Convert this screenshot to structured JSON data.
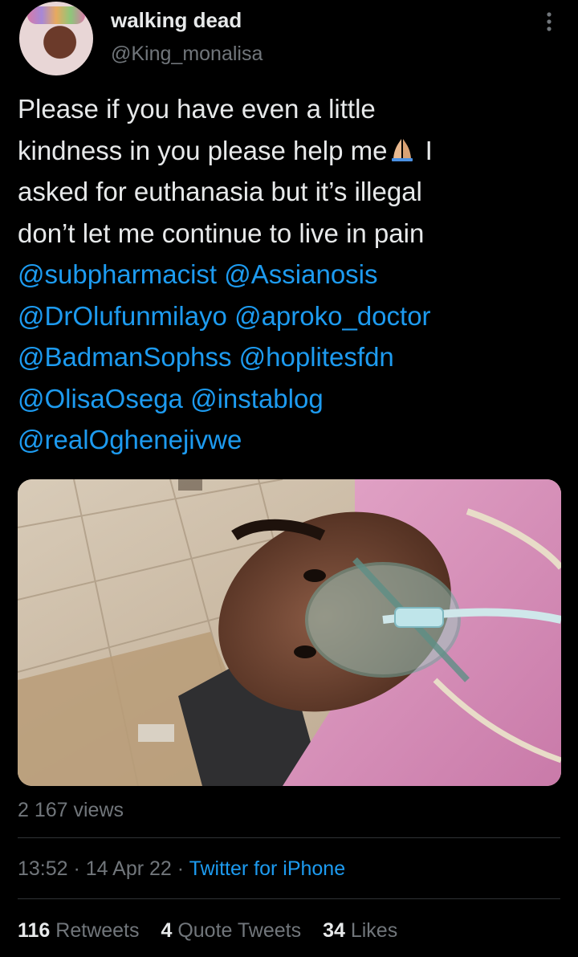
{
  "author": {
    "display_name": "walking dead",
    "handle": "@King_monalisa"
  },
  "tweet": {
    "lines": [
      [
        "Please if you have even a little"
      ],
      [
        "kindness in you please help me",
        "🙏",
        " I"
      ],
      [
        "asked for euthanasia but it’s illegal"
      ],
      [
        "don’t let me continue to live in pain"
      ]
    ],
    "line1": "Please if you have even a little",
    "line2_a": "kindness in you please help me",
    "line2_b": " I",
    "line3": "asked for euthanasia but it’s illegal",
    "line4": "don’t let me continue to live in pain",
    "mentions": [
      "@subpharmacist",
      "@Assianosis",
      "@DrOlufunmilayo",
      "@aproko_doctor",
      "@BadmanSophss",
      "@hoplitesfdn",
      "@OlisaOsega",
      "@instablog",
      "@realOghenejivwe"
    ],
    "emoji": "folded-hands-emoji"
  },
  "views": "2 167 views",
  "meta": {
    "time": "13:52",
    "separator": " · ",
    "date": "14 Apr 22",
    "source": "Twitter for iPhone"
  },
  "stats": {
    "retweets_count": "116",
    "retweets_label": " Retweets",
    "quotes_count": "4",
    "quotes_label": " Quote Tweets",
    "likes_count": "34",
    "likes_label": " Likes"
  },
  "colors": {
    "background": "#000000",
    "text": "#e7e9ea",
    "secondary": "#71767b",
    "link": "#1d9bf0",
    "divider": "#2f3336"
  },
  "icons": {
    "more": "more-vertical-icon"
  }
}
